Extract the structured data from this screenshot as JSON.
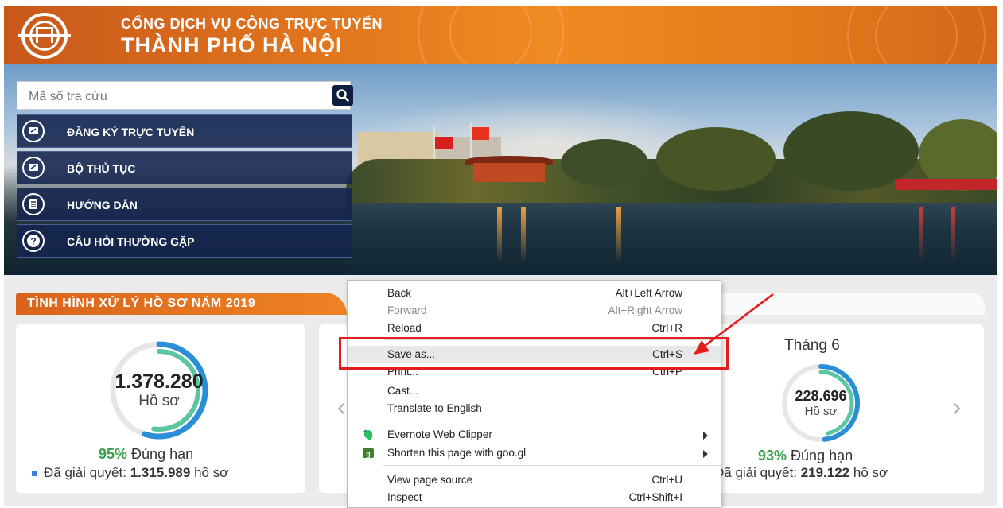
{
  "header": {
    "title_line1": "CỔNG DỊCH VỤ CÔNG TRỰC TUYẾN",
    "title_line2": "THÀNH PHỐ HÀ NỘI",
    "logo": "hanoi-emblem-icon"
  },
  "search": {
    "placeholder": "Mã số tra cứu",
    "icon": "search-icon"
  },
  "menu": {
    "items": [
      {
        "label": "ĐĂNG KÝ TRỰC TUYẾN",
        "icon": "edit-icon"
      },
      {
        "label": "BỘ THỦ TỤC",
        "icon": "edit-icon"
      },
      {
        "label": "HƯỚNG DẪN",
        "icon": "guide-icon"
      },
      {
        "label": "CÂU HỎI THƯỜNG GẶP",
        "icon": "question-icon"
      }
    ]
  },
  "stats": {
    "tab_title": "TÌNH HÌNH XỬ LÝ HỒ SƠ NĂM 2019",
    "year_card": {
      "total": "1.378.280",
      "unit": "Hồ sơ",
      "pct": "95%",
      "pct_label": "Đúng hạn",
      "solved_prefix": "Đã giải quyết:",
      "solved_value": "1.315.989",
      "solved_suffix": "hồ sơ",
      "ontime_fraction": 0.95
    },
    "month_card": {
      "month": "Tháng 6",
      "total": "228.696",
      "unit": "Hồ sơ",
      "pct": "93%",
      "pct_label": "Đúng hạn",
      "solved_prefix": "Đã giải quyết:",
      "solved_value": "219.122",
      "solved_suffix": "hồ sơ",
      "ontime_fraction": 0.93
    }
  },
  "context_menu": {
    "items": [
      {
        "label": "Back",
        "shortcut": "Alt+Left Arrow",
        "disabled": false
      },
      {
        "label": "Forward",
        "shortcut": "Alt+Right Arrow",
        "disabled": true
      },
      {
        "label": "Reload",
        "shortcut": "Ctrl+R",
        "disabled": false
      },
      {
        "label": "Save as...",
        "shortcut": "Ctrl+S",
        "disabled": false
      },
      {
        "label": "Print...",
        "shortcut": "Ctrl+P",
        "disabled": false
      },
      {
        "label": "Cast...",
        "shortcut": "",
        "disabled": false
      },
      {
        "label": "Translate to English",
        "shortcut": "",
        "disabled": false
      },
      {
        "label": "Evernote Web Clipper",
        "shortcut": "",
        "disabled": false
      },
      {
        "label": "Shorten this page with goo.gl",
        "shortcut": "",
        "disabled": false
      },
      {
        "label": "View page source",
        "shortcut": "Ctrl+U",
        "disabled": false
      },
      {
        "label": "Inspect",
        "shortcut": "Ctrl+Shift+I",
        "disabled": false
      }
    ]
  },
  "colors": {
    "header_orange": "#e8761e",
    "menu_navy": "#14244e",
    "ontime_green": "#3aa14a",
    "donut_blue": "#2a8fd6",
    "donut_teal": "#5cc6a0",
    "highlight_red": "#e21d1d"
  }
}
